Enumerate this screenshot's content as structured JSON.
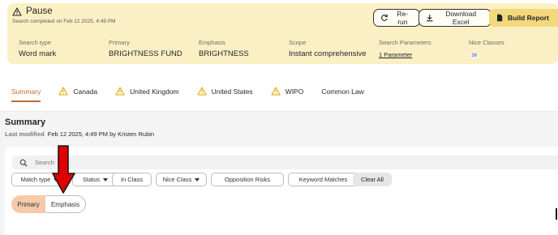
{
  "status": {
    "title": "Pause",
    "subtitle": "Search completed on Feb 12 2025, 4:49 PM",
    "icon": "warning-icon"
  },
  "actions": {
    "rerun": "Re-run",
    "download": "Download Excel",
    "build": "Build Report"
  },
  "meta": {
    "search_type_label": "Search type",
    "search_type": "Word mark",
    "primary_label": "Primary",
    "primary": "BRIGHTNESS FUND",
    "emphasis_label": "Emphasis",
    "emphasis": "BRIGHTNESS",
    "scope_label": "Scope",
    "scope": "Instant comprehensive",
    "params_label": "Search Parameters",
    "params": "1 Parameter",
    "nice_label": "Nice Classes",
    "nice": "36"
  },
  "tabs": [
    {
      "label": "Summary",
      "active": true
    },
    {
      "label": "Canada",
      "warning": true
    },
    {
      "label": "United Kingdom",
      "warning": true
    },
    {
      "label": "United States",
      "warning": true
    },
    {
      "label": "WIPO",
      "warning": true
    },
    {
      "label": "Common Law"
    }
  ],
  "summary": {
    "title": "Summary",
    "last_modified_label": "Last modified",
    "last_modified_value": "Feb 12 2025, 4:49 PM by Kristen Rubin",
    "search_placeholder": "Search"
  },
  "filters": {
    "match_type": "Match type",
    "status": "Status",
    "in_class": "In Class",
    "nice_class": "Nice Class",
    "opposition_risks": "Opposition Risks",
    "keyword_matches": "Keyword Matches",
    "clear_all": "Clear All"
  },
  "toggle": {
    "primary": "Primary",
    "emphasis": "Emphasis"
  },
  "colors": {
    "banner": "#fbf0c4",
    "accent": "#c56a2e",
    "build_button": "#f3d97c",
    "warning": "#e0a800",
    "annotation_arrow": "#e00000"
  }
}
